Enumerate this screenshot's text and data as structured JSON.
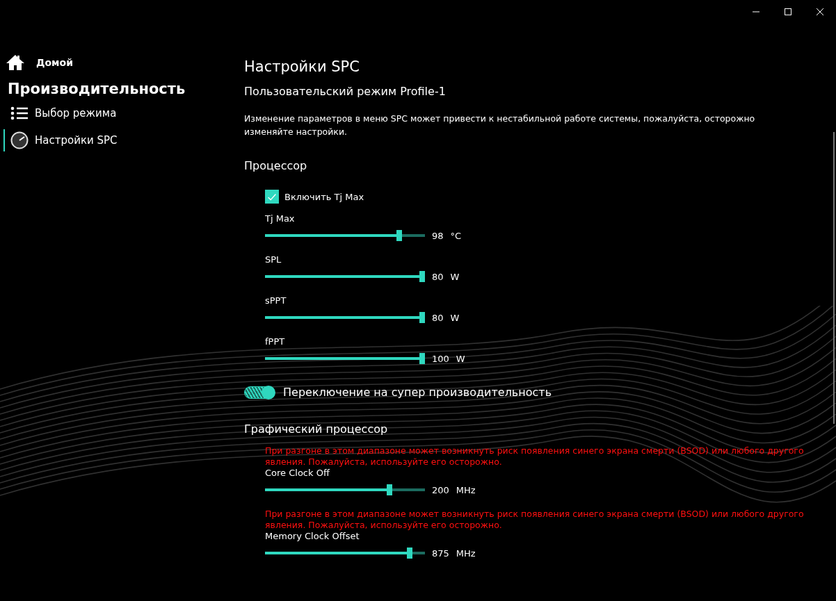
{
  "sidebar": {
    "home": {
      "label": "Домой"
    },
    "section": "Производительность",
    "items": [
      {
        "label": "Выбор режима",
        "selected": false
      },
      {
        "label": "Настройки SPC",
        "selected": true
      }
    ]
  },
  "page": {
    "title": "Настройки SPC",
    "subtitle": "Пользовательский режим Profile-1",
    "notice": "Изменение параметров в меню SPC может привести к нестабильной работе системы, пожалуйста, осторожно изменяйте настройки."
  },
  "cpu": {
    "title": "Процессор",
    "checkbox": {
      "label": "Включить Tj Max",
      "checked": true
    },
    "sliders": [
      {
        "label": "Tj Max",
        "level": 0.85,
        "value": "98",
        "unit": "°C"
      },
      {
        "label": "SPL",
        "level": 1,
        "value": "80",
        "unit": "W"
      },
      {
        "label": "sPPT",
        "level": 1,
        "value": "80",
        "unit": "W"
      },
      {
        "label": "fPPT",
        "level": 1,
        "value": "100",
        "unit": "W"
      }
    ],
    "toggle": {
      "label": "Переключение на супер производительность",
      "on": true
    }
  },
  "gpu": {
    "title": "Графический процессор",
    "sliders": [
      {
        "warning": "При разгоне в этом диапазоне может возникнуть риск появления синего экрана смерти (BSOD) или любого другого явления. Пожалуйста, используйте его осторожно.",
        "label": "Core Clock Off",
        "level": 0.79,
        "value": "200",
        "unit": "MHz"
      },
      {
        "warning": "При разгоне в этом диапазоне может возникнуть риск появления синего экрана смерти (BSOD) или любого другого явления. Пожалуйста, используйте его осторожно.",
        "label": "Memory Clock Offset",
        "level": 0.92,
        "value": "875",
        "unit": "MHz"
      }
    ]
  }
}
